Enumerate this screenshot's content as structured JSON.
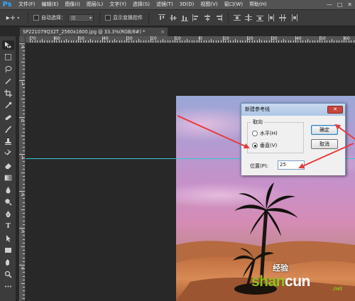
{
  "app": {
    "logo": "Ps",
    "menu": [
      "文件(F)",
      "编辑(E)",
      "图像(I)",
      "图层(L)",
      "文字(Y)",
      "选择(S)",
      "滤镜(T)",
      "3D(D)",
      "视图(V)",
      "窗口(W)",
      "帮助(H)"
    ],
    "window_controls": [
      "—",
      "□",
      "✕"
    ]
  },
  "options_bar": {
    "tool_glyph": "▸+",
    "auto_select_label": "自动选择：",
    "auto_select_value": "组",
    "show_transform_label": "显示变换控件"
  },
  "document": {
    "tab_title": "SP221079Q32T_2560x1600.jpg @ 33.3%(RGB/8#) *",
    "tab_close": "×"
  },
  "rulers": {
    "h_labels": [
      "70",
      "60",
      "50",
      "40",
      "30",
      "20",
      "10",
      "0",
      "10",
      "20",
      "30",
      "40",
      "50",
      "60"
    ],
    "v_labels": [
      "2",
      "1",
      "0",
      "1",
      "2",
      "3",
      "4"
    ]
  },
  "dialog": {
    "title": "新建参考线",
    "close": "✕",
    "orientation_legend": "取向",
    "horizontal_label": "水平(H)",
    "vertical_label": "垂直(V)",
    "selected_orientation": "vertical",
    "ok_label": "确定",
    "cancel_label": "取消",
    "position_label": "位置(P):",
    "position_value": "25"
  },
  "watermark": {
    "jingyan": "经验",
    "shancun_green": "shan",
    "shancun_white": "cun",
    "net": ".net"
  },
  "colors": {
    "guide": "#37c8d6",
    "arrow": "#e83a3a",
    "ps_blue": "#31a8ff"
  }
}
